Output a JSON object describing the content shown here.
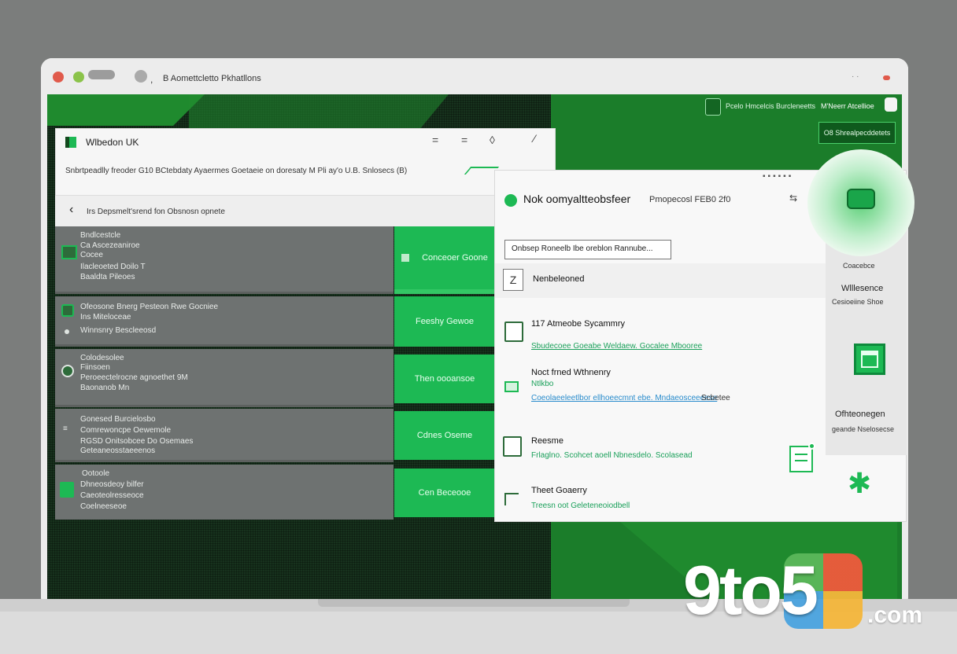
{
  "window": {
    "tab_title": "B Aomettcletto Pkhatllons",
    "colors": {
      "close": "#e05a4b",
      "minimize": "#8bc34a",
      "brand_green": "#1db954",
      "dark_green": "#1c7e2a"
    }
  },
  "topbar": {
    "account_label": "Pcelo Hmcelcis Burcleneetts",
    "user_label": "M'Neerr Atcellioe",
    "action_button": "O8 Shrealpecddetets"
  },
  "left_panel": {
    "brand": "Wlbedon UK",
    "subtitle": "Snbrtpeadlly freoder G10 BCtebdaty Ayaermes Goetaeie on doresaty M Pli ay'o U.B. Snlosecs (B)",
    "breadcrumb": "Irs Depsmelt'srend fon Obsnosn opnete",
    "rows": [
      {
        "title": "Bndlcestcle",
        "lines": [
          "Ca Ascezeaniroe",
          "Cocee",
          "Ilacleoeted Doilo T",
          "Baaldta Pileoes"
        ],
        "action": "Conceoer Goone"
      },
      {
        "title": "Ofeosone Bnerg Pesteon Rwe Gocniee",
        "lines": [
          "Ins Miteloceae",
          "Winnsnry Bescleeosd"
        ],
        "action": "Feeshy Gewoe"
      },
      {
        "title": "Colodesolee",
        "lines": [
          "Fiinsoen",
          "Peroeectelrocne agnoethet 9M",
          "Baonanob Mn"
        ],
        "action": "Then oooansoe"
      },
      {
        "title": "Gonesed Burcielosbo",
        "lines": [
          "Comrewoncpe Oewemole",
          "RGSD Onitsobcee Do Osemaes",
          "Geteaneosstaeeenos"
        ],
        "action": "Cdnes Oseme"
      },
      {
        "title": "Ootoole",
        "lines": [
          "Dhneosdeoy bilfer",
          "Caeoteolresseoce",
          "Coelneeseoe"
        ],
        "action": "Cen Beceooe"
      }
    ]
  },
  "right_panel": {
    "title": "Nok oomyaltteobsfeer",
    "subtitle": "Pmopecosl FEB0 2f0",
    "search_value": "Onbsep Roneelb Ibe oreblon Rannube...",
    "section_label": "Nenbeleoned",
    "items": [
      {
        "title": "117 Atmeobe Sycammry",
        "detail": "Sbudecoee Goeabe Weldaew. Gocalee Mbooree"
      },
      {
        "title": "Noct frned Wthnenry",
        "detail": "Ntlkbo",
        "extra": "Coeolaeeleetlbor ellhoeecmnt ebe. Mndaeosceeeese",
        "extra2": "Scbetee"
      },
      {
        "title": "Reesme",
        "detail": "Frlaglno. Scohcet aoell Nbnesdelo. Scolasead"
      },
      {
        "title": "Theet Goaerry",
        "detail": "Treesn oot Geleteneoiodbell"
      }
    ],
    "side": {
      "top_label": "Coacebce",
      "heading": "Wlllesence",
      "sub": "Cesioeiine Shoe",
      "bottom_heading": "Ofhteonegen",
      "bottom_sub": "geande Nselosecse"
    }
  },
  "watermark": {
    "text": "9to5",
    "suffix": ".com"
  }
}
